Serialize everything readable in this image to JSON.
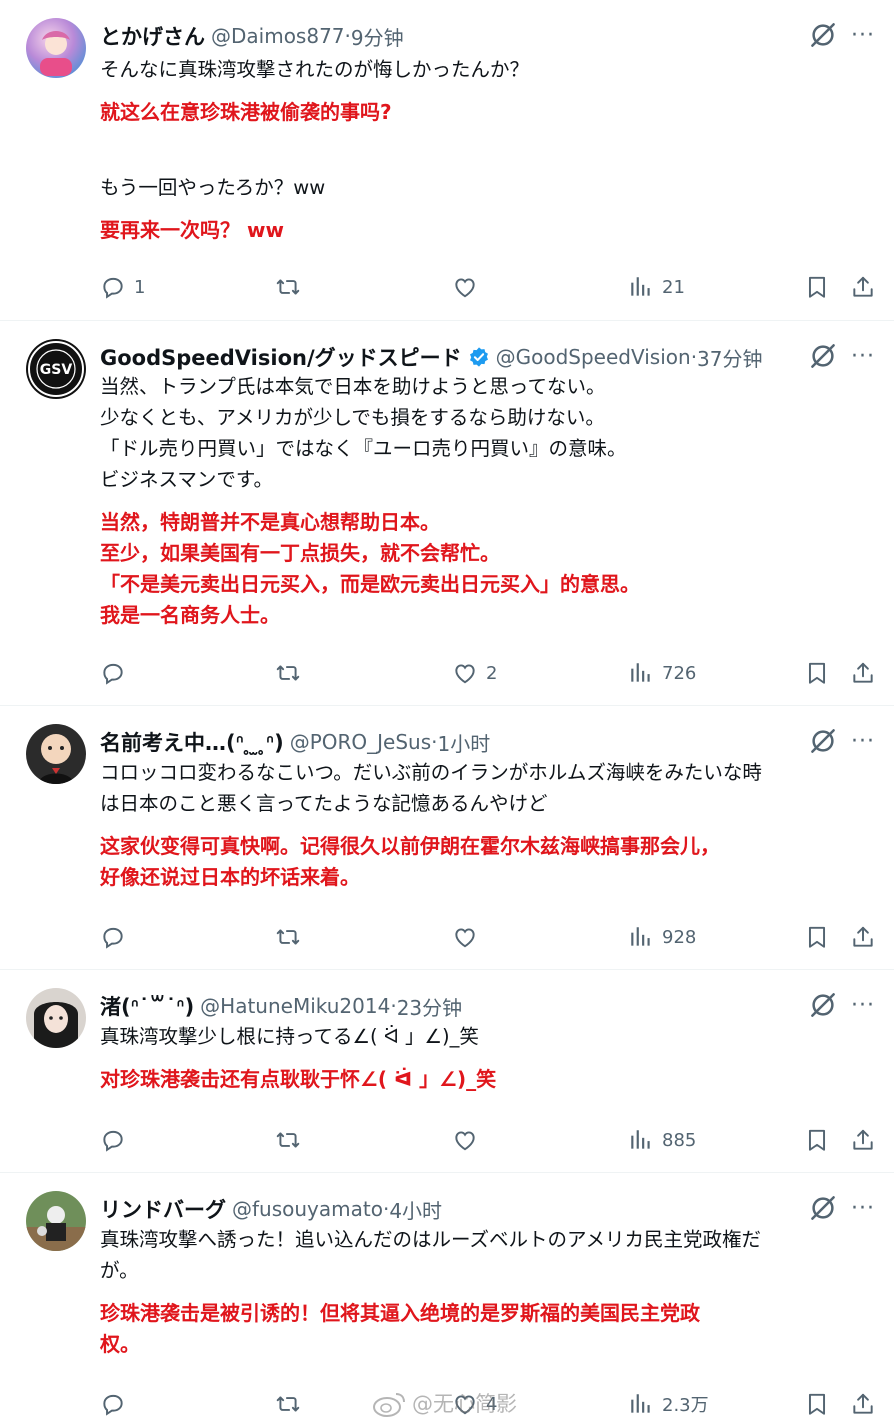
{
  "tweets": [
    {
      "name": "とかげさん",
      "handle": "@Daimos877",
      "time": "9分钟",
      "verified": false,
      "jp1": "そんなに真珠湾攻撃されたのが悔しかったんか？",
      "cn1": "就这么在意珍珠港被偷袭的事吗?",
      "jp2": "もう一回やったろか？ww",
      "cn2": "要再来一次吗？ ww",
      "replies": "1",
      "retweets": "",
      "likes": "",
      "views": "21"
    },
    {
      "name": "GoodSpeedVision/グッドスピード",
      "handle": "@GoodSpeedVision",
      "time": "37分钟",
      "verified": true,
      "avatar_text": "GSV",
      "jp1": "当然、トランプ氏は本気で日本を助けようと思ってない。\n少なくとも、アメリカが少しでも損をするなら助けない。\n「ドル売り円買い」ではなく『ユーロ売り円買い』の意味。\nビジネスマンです。",
      "cn1": "当然，特朗普并不是真心想帮助日本。\n至少，如果美国有一丁点损失，就不会帮忙。\n「不是美元卖出日元买入，而是欧元卖出日元买入」的意思。\n我是一名商务人士。",
      "replies": "",
      "retweets": "",
      "likes": "2",
      "views": "726"
    },
    {
      "name": "名前考え中…(ᐢ ̥ ̫ ̥ᐢ)",
      "handle": "@PORO_JeSus",
      "time": "1小时",
      "verified": false,
      "jp1": "コロッコロ変わるなこいつ。だいぶ前のイランがホルムズ海峡をみたいな時\nは日本のこと悪く言ってたような記憶あるんやけど",
      "cn1": "这家伙变得可真快啊。记得很久以前伊朗在霍尔木兹海峡搞事那会儿，\n好像还说过日本的坏话来着。",
      "replies": "",
      "retweets": "",
      "likes": "",
      "views": "928"
    },
    {
      "name": "渚(ᐢ˙꒳˙ᐢ)",
      "handle": "@HatuneMiku2014",
      "time": "23分钟",
      "verified": false,
      "jp1": "真珠湾攻撃少し根に持ってる∠( ᐛ 」∠)_笑",
      "cn1": "对珍珠港袭击还有点耿耿于怀∠( ᐛ 」∠)_笑",
      "replies": "",
      "retweets": "",
      "likes": "",
      "views": "885"
    },
    {
      "name": "リンドバーグ",
      "handle": "@fusouyamato",
      "time": "4小时",
      "verified": false,
      "jp1": "真珠湾攻撃へ誘った！追い込んだのはルーズベルトのアメリカ民主党政権だ\nが。",
      "cn1": "珍珠港袭击是被引诱的！但将其逼入绝境的是罗斯福的美国民主党政\n权。",
      "replies": "",
      "retweets": "",
      "likes": "4",
      "views": "2.3万"
    }
  ],
  "separator": " · ",
  "watermark": "@无心简影",
  "colors": {
    "translation": "#e0161c",
    "secondary": "#536471",
    "verified": "#1d9bf0"
  }
}
